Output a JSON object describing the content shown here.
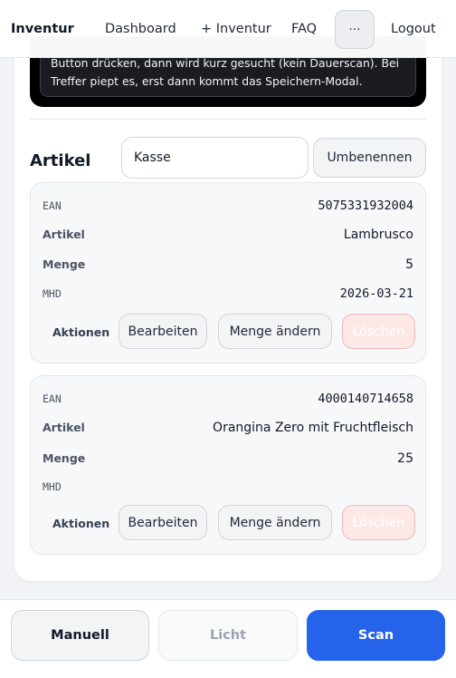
{
  "nav": {
    "brand": "Inventur",
    "links": [
      "Dashboard",
      "+ Inventur",
      "FAQ"
    ],
    "more": "···",
    "logout": "Logout"
  },
  "scanner": {
    "hint_line1": "Button drücken, dann wird kurz gesucht (kein Dauerscan). Bei",
    "hint_line2": "Treffer piept es, erst dann kommt das Speichern-Modal."
  },
  "articles": {
    "title": "Artikel",
    "name_value": "Kasse",
    "rename_label": "Umbenennen",
    "labels": {
      "ean": "EAN",
      "artikel": "Artikel",
      "menge": "Menge",
      "mhd": "MHD",
      "aktionen": "Aktionen"
    },
    "items": [
      {
        "ean": "5075331932004",
        "artikel": "Lambrusco",
        "menge": "5",
        "mhd": "2026-03-21"
      },
      {
        "ean": "4000140714658",
        "artikel": "Orangina Zero mit Fruchtfleisch",
        "menge": "25",
        "mhd": ""
      }
    ],
    "actions": {
      "edit": "Bearbeiten",
      "qty": "Menge ändern",
      "delete": "Löschen"
    }
  },
  "bottom": {
    "manual": "Manuell",
    "light": "Licht",
    "scan": "Scan"
  },
  "colors": {
    "primary": "#2563eb",
    "danger_bg": "#fde8e8",
    "scanner_bg": "#000000"
  }
}
